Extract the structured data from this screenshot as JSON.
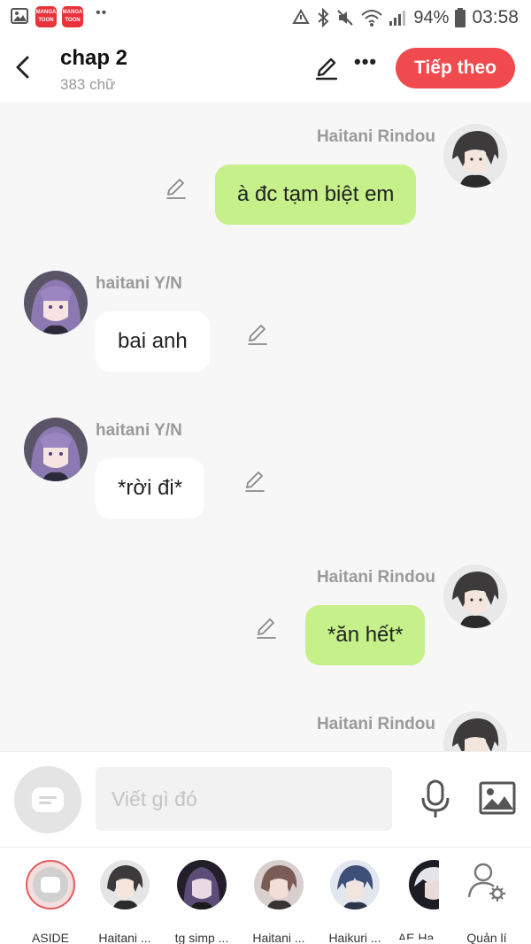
{
  "status_bar": {
    "app_badge": "MANGA TOON",
    "dots": "••",
    "battery_percent": "94%",
    "time": "03:58"
  },
  "header": {
    "title": "chap 2",
    "word_count": "383 chữ",
    "next_label": "Tiếp theo"
  },
  "messages": [
    {
      "sender": "Haitani Rindou",
      "side": "right",
      "text": "à đc tạm biệt em",
      "bubble_color": "#c5f08a"
    },
    {
      "sender": "haitani Y/N",
      "side": "left",
      "text": "bai anh",
      "bubble_color": "#ffffff"
    },
    {
      "sender": "haitani Y/N",
      "side": "left",
      "text": "*rời đi*",
      "bubble_color": "#ffffff"
    },
    {
      "sender": "Haitani Rindou",
      "side": "right",
      "text": "*ăn hết*",
      "bubble_color": "#c5f08a"
    },
    {
      "sender": "Haitani Rindou",
      "side": "right"
    }
  ],
  "input": {
    "placeholder": "Viết gì đó"
  },
  "characters": [
    {
      "label": "ASIDE"
    },
    {
      "label": "Haitani ..."
    },
    {
      "label": "tg simp ..."
    },
    {
      "label": "Haitani ..."
    },
    {
      "label": "Haikuri ..."
    },
    {
      "label": "AE Ha"
    }
  ],
  "manage_label": "Quản lí",
  "colors": {
    "accent": "#f04a4e",
    "green_bubble": "#c5f08a",
    "name_gray": "#9a9a9a"
  }
}
